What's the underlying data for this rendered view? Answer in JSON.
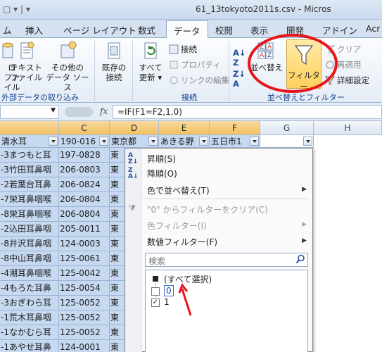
{
  "window": {
    "qat": "▢ ▾ | ▾",
    "title": "61_13tokyoto2011s.csv - Micros"
  },
  "tabs": [
    "ム",
    "挿入",
    "ページ レイアウト",
    "数式",
    "データ",
    "校閲",
    "表示",
    "開発",
    "アドイン",
    "Acr"
  ],
  "ribbon": {
    "external": {
      "btn_fro_1": "ロ",
      "btn_fro_2": "ファイル",
      "text_1": "テキスト",
      "text_2": "ファイル",
      "other_1": "その他の",
      "other_2": "データ ソース",
      "existing_1": "既存の",
      "existing_2": "接続",
      "group": "外部データの取り込み"
    },
    "connections": {
      "refresh_1": "すべて",
      "refresh_2": "更新",
      "connections": "接続",
      "properties": "プロパティ",
      "edit_links": "リンクの編集",
      "group": "接続"
    },
    "sort_filter": {
      "sort": "並べ替え",
      "filter": "フィルター",
      "clear": "クリア",
      "reapply": "再適用",
      "advanced": "詳細設定",
      "group": "並べ替えとフィルター"
    }
  },
  "formula_bar": {
    "fx": "fx",
    "formula": "=IF(F1=F2,1,0)"
  },
  "columns": {
    "c": "C",
    "d": "D",
    "e": "E",
    "f": "F",
    "g": "G",
    "h": "H"
  },
  "filter_row": {
    "b": "清水耳",
    "c": "190-016",
    "d": "東京都",
    "e": "あきる野",
    "f": "五日市1"
  },
  "rows": [
    {
      "b": "-3まつもと耳",
      "c": "197-0828",
      "d": "東"
    },
    {
      "b": "-3竹田耳鼻咽",
      "c": "206-0803",
      "d": "東"
    },
    {
      "b": "-2若葉台耳鼻",
      "c": "206-0824",
      "d": "東"
    },
    {
      "b": "-7栄耳鼻咽喉",
      "c": "206-0804",
      "d": "東"
    },
    {
      "b": "-8栄耳鼻咽喉",
      "c": "206-0804",
      "d": "東"
    },
    {
      "b": "-2込田耳鼻咽",
      "c": "205-0011",
      "d": "東"
    },
    {
      "b": "-8井沢耳鼻咽",
      "c": "124-0003",
      "d": "東"
    },
    {
      "b": "-8中山耳鼻咽",
      "c": "125-0061",
      "d": "東"
    },
    {
      "b": "-4潮耳鼻咽喉",
      "c": "125-0042",
      "d": "東"
    },
    {
      "b": "-4もろた耳鼻",
      "c": "125-0054",
      "d": "東"
    },
    {
      "b": "-3おぎわら耳",
      "c": "125-0052",
      "d": "東"
    },
    {
      "b": "-1荒木耳鼻咽",
      "c": "125-0052",
      "d": "東"
    },
    {
      "b": "-1なかむら耳",
      "c": "125-0052",
      "d": "東"
    },
    {
      "b": "-1あやせ耳鼻",
      "c": "124-0001",
      "d": "東"
    },
    {
      "b": "-8新小岩耳鼻",
      "c": "124-0024",
      "d": "東"
    },
    {
      "b": "-5あみ耳鼻咽",
      "c": "125-0032",
      "d": "東"
    }
  ],
  "menu": {
    "sort_asc": "昇順(S)",
    "sort_desc": "降順(O)",
    "sort_color": "色で並べ替え(T)",
    "clear_filter": "\"0\" からフィルターをクリア(C)",
    "color_filter": "色フィルター(I)",
    "number_filter": "数値フィルター(F)",
    "search_placeholder": "検索",
    "select_all": "(すべて選択)",
    "item_0": "0",
    "item_1": "1"
  },
  "colors": {
    "accent_tab": "#fbfcfe",
    "highlight_circle": "#e8141c",
    "annotation_arrow": "#e8141c",
    "selected_cells": "#c6d9f1"
  }
}
